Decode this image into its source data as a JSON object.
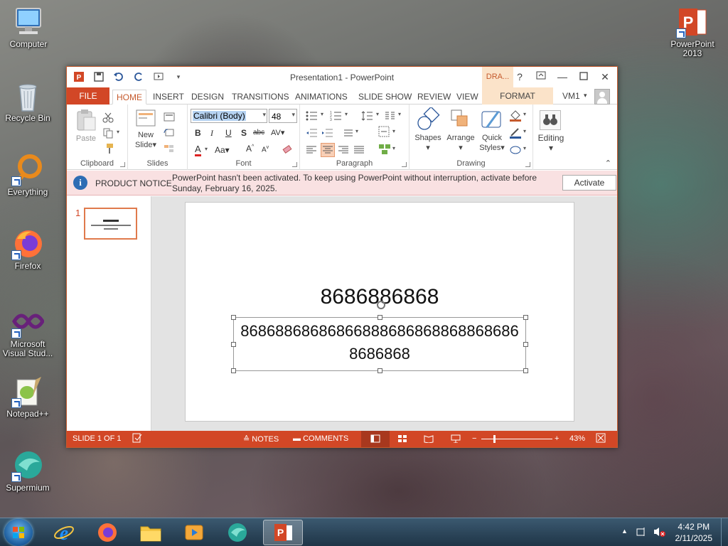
{
  "desktop": {
    "icons": [
      {
        "label": "Computer"
      },
      {
        "label": "Recycle Bin"
      },
      {
        "label": "Everything"
      },
      {
        "label": "Firefox"
      },
      {
        "label": "Microsoft Visual Stud..."
      },
      {
        "label": "Notepad++"
      },
      {
        "label": "Supermium"
      },
      {
        "label": "PowerPoint 2013"
      }
    ]
  },
  "window": {
    "title": "Presentation1 - PowerPoint",
    "contextual_tab_group": "DRA...",
    "help_label": "?",
    "tabs": {
      "file": "FILE",
      "home": "HOME",
      "insert": "INSERT",
      "design": "DESIGN",
      "transitions": "TRANSITIONS",
      "animations": "ANIMATIONS",
      "slideshow": "SLIDE SHOW",
      "review": "REVIEW",
      "view": "VIEW",
      "format": "FORMAT"
    },
    "user": "VM1"
  },
  "ribbon": {
    "clipboard": {
      "label": "Clipboard",
      "paste": "Paste"
    },
    "slides": {
      "label": "Slides",
      "new_slide_line1": "New",
      "new_slide_line2": "Slide"
    },
    "font": {
      "label": "Font",
      "font_name": "Calibri (Body)",
      "font_size": "48"
    },
    "paragraph": {
      "label": "Paragraph"
    },
    "drawing": {
      "label": "Drawing",
      "shapes": "Shapes",
      "arrange": "Arrange",
      "quick_styles_1": "Quick",
      "quick_styles_2": "Styles"
    },
    "editing": {
      "label": "Editing"
    }
  },
  "notice": {
    "title": "PRODUCT NOTICE",
    "message": "PowerPoint hasn't been activated. To keep using PowerPoint without interruption, activate before Sunday, February 16, 2025.",
    "button": "Activate"
  },
  "slides_pane": {
    "number": "1"
  },
  "slide": {
    "title": "8686886868",
    "subtitle": "86868868686866888686868868868686 8686868"
  },
  "status": {
    "slide_info": "SLIDE 1 OF 1",
    "notes": "NOTES",
    "comments": "COMMENTS",
    "zoom": "43%"
  },
  "taskbar": {
    "time": "4:42 PM",
    "date": "2/11/2025"
  },
  "colors": {
    "accent": "#d24726",
    "notice_bg": "#f9e1e2"
  }
}
